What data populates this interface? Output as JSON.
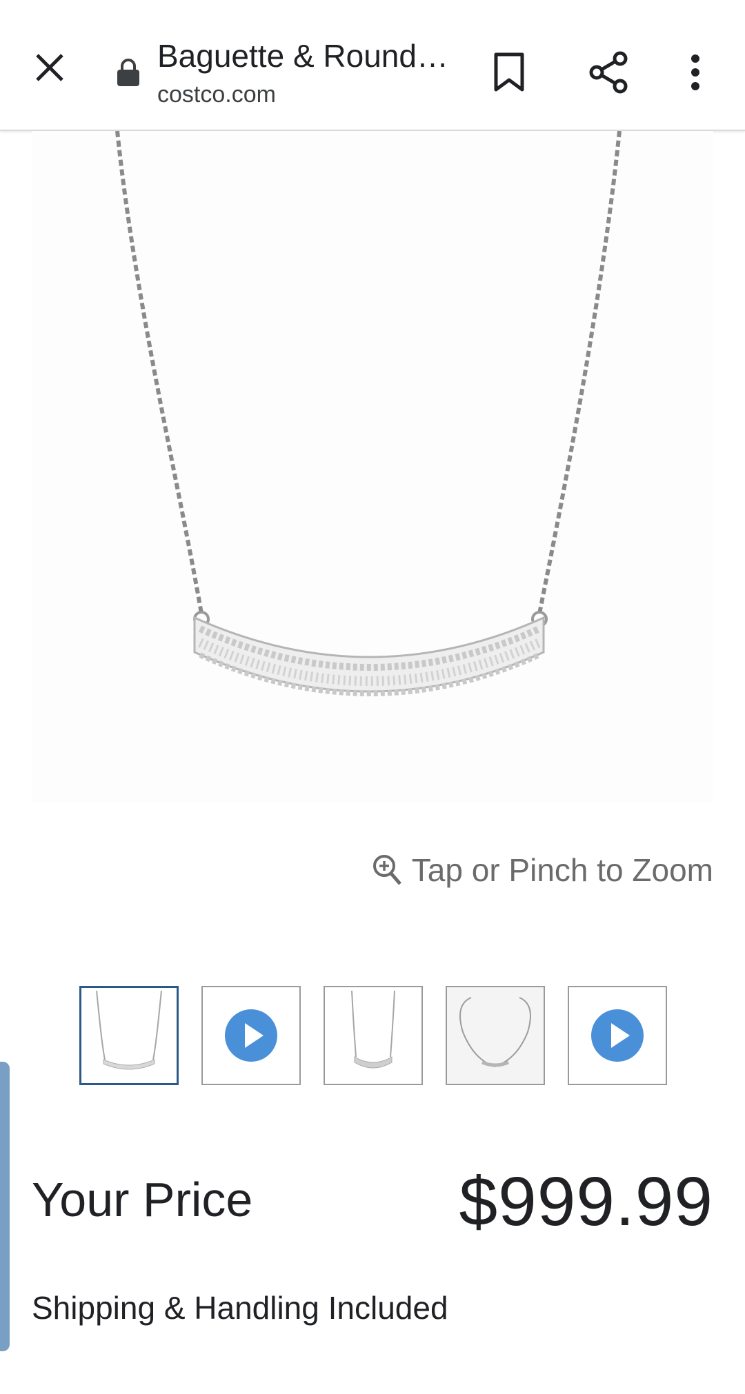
{
  "topbar": {
    "title": "Baguette & Round…",
    "domain": "costco.com",
    "icons": {
      "close": "close-icon",
      "lock": "lock-icon",
      "bookmark": "bookmark-icon",
      "share": "share-icon",
      "more": "more-vert-icon"
    }
  },
  "zoom": {
    "label": "Tap or Pinch to Zoom",
    "icon": "zoom-in-icon"
  },
  "thumbnails": [
    {
      "type": "image",
      "selected": true
    },
    {
      "type": "video",
      "selected": false
    },
    {
      "type": "image",
      "selected": false
    },
    {
      "type": "image",
      "selected": false
    },
    {
      "type": "video",
      "selected": false
    }
  ],
  "price": {
    "label": "Your Price",
    "value": "$999.99"
  },
  "shipping": "Shipping & Handling Included",
  "colors": {
    "accent_blue": "#4a90d9",
    "selected_border": "#2a5a8a",
    "side_tab": "#7a9fc4"
  }
}
